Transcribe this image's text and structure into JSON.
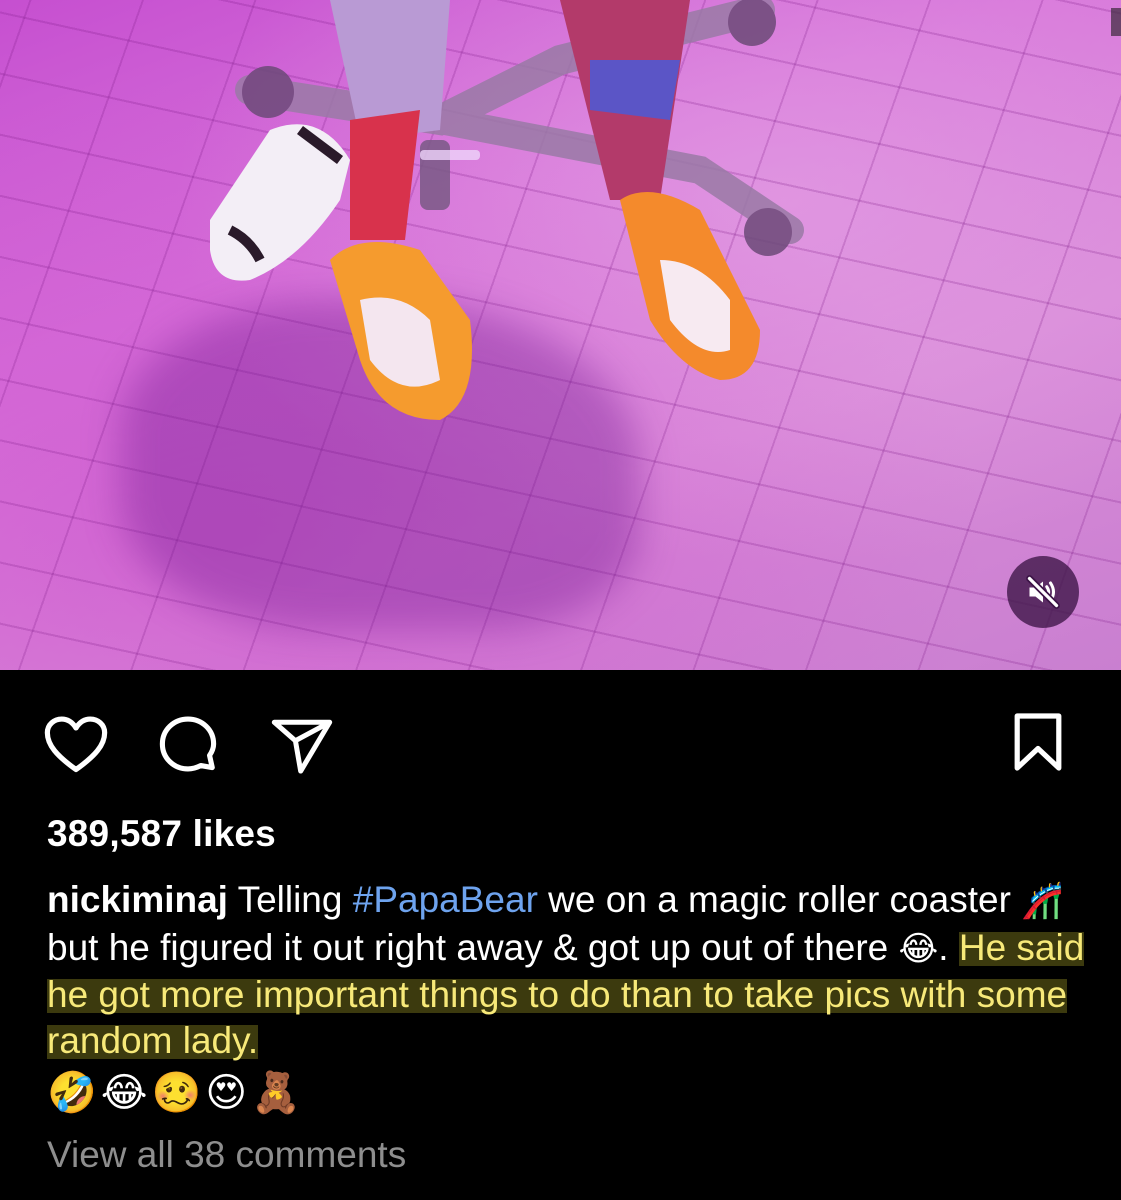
{
  "post": {
    "media": {
      "type": "video",
      "audio_icon": "speaker-muted-icon"
    },
    "actions": {
      "like_icon": "heart-icon",
      "comment_icon": "comment-bubble-icon",
      "share_icon": "paper-plane-icon",
      "save_icon": "bookmark-icon"
    },
    "likes_text": "389,587 likes",
    "caption": {
      "username": "nickiminaj",
      "part1": " Telling ",
      "hashtag": "#PapaBear",
      "part2": " we on a magic roller coaster ",
      "emoji_coaster": "🎢",
      "part3": " but he figured it out right away & got up out of there ",
      "emoji_laugh": "😂",
      "part4": ". ",
      "highlighted": "He said he got more important things to do than to take pics with some random lady.",
      "emoji_line": "🤣😂🥴😍🧸"
    },
    "view_comments": "View all 38 comments",
    "colors": {
      "background": "#000000",
      "text": "#ffffff",
      "hashtag": "#6ea3ee",
      "highlight_text": "#f7e979",
      "muted_text": "#8e8e8e"
    }
  }
}
